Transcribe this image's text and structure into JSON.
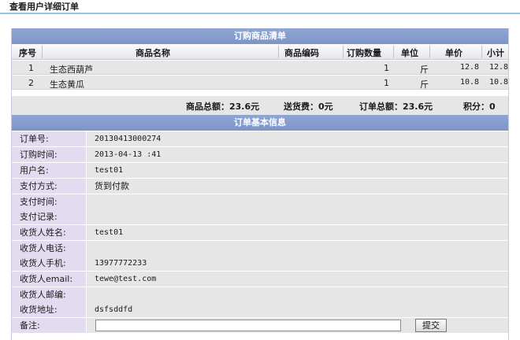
{
  "page_title": "查看用户详细订单",
  "goods_section": {
    "title": "订购商品清单",
    "columns": [
      "序号",
      "商品名称",
      "商品编码",
      "订购数量",
      "单位",
      "单价",
      "小计"
    ],
    "rows": [
      {
        "index": "1",
        "name": "生态西葫芦",
        "code": "",
        "qty": "1",
        "unit": "斤",
        "price": "12.8",
        "subtotal": "12.8"
      },
      {
        "index": "2",
        "name": "生态黄瓜",
        "code": "",
        "qty": "1",
        "unit": "斤",
        "price": "10.8",
        "subtotal": "10.8"
      }
    ],
    "summary": {
      "goods_total": "商品总额：23.6元",
      "shipping": "送货费：0元",
      "order_total": "订单总额：23.6元",
      "points": "积分：0"
    }
  },
  "basic_section": {
    "title": "订单基本信息",
    "fields": [
      {
        "label": "订单号:",
        "value": "20130413000274"
      },
      {
        "label": "订购时间:",
        "value": "2013-04-13 :41"
      },
      {
        "label": "用户名:",
        "value": "test01"
      },
      {
        "label": "支付方式:",
        "value": "货到付款"
      },
      {
        "label": "支付时间:",
        "value": ""
      },
      {
        "label": "支付记录:",
        "value": ""
      },
      {
        "label": "收货人姓名:",
        "value": "test01"
      },
      {
        "label": "收货人电话:",
        "value": ""
      },
      {
        "label": "收货人手机:",
        "value": "13977772233"
      },
      {
        "label": "收货人email:",
        "value": "tewe@test.com"
      },
      {
        "label": "收货人邮编:",
        "value": ""
      },
      {
        "label": "收货地址:",
        "value": "dsfsddfd"
      }
    ],
    "remark": {
      "label": "备注:",
      "value": "",
      "submit_label": "提交"
    }
  }
}
